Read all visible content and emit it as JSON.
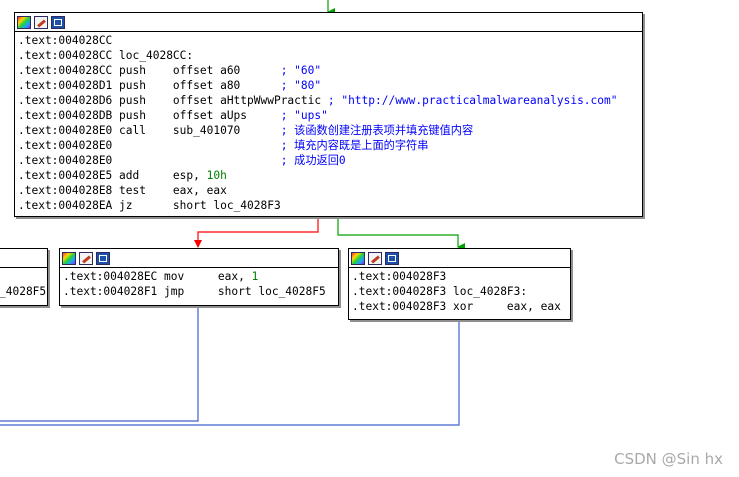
{
  "colors": {
    "edge_true": "#00a000",
    "edge_false": "#ff0000",
    "edge_uncond": "#4060d0"
  },
  "nodes": {
    "main": {
      "lines": [
        [
          ".text:004028CC"
        ],
        [
          ".text:004028CC ",
          "loc_4028CC:"
        ],
        [
          ".text:004028CC ",
          "push    offset a60      ",
          "; \"60\""
        ],
        [
          ".text:004028D1 ",
          "push    offset a80      ",
          "; \"80\""
        ],
        [
          ".text:004028D6 ",
          "push    offset aHttpWwwPractic ",
          "; \"http://www.practicalmalwareanalysis.com\""
        ],
        [
          ".text:004028DB ",
          "push    offset aUps     ",
          "; \"ups\""
        ],
        [
          ".text:004028E0 ",
          "call    sub_401070      ",
          "; 该函数创建注册表项并填充键值内容"
        ],
        [
          ".text:004028E0 ",
          "                        ",
          "; 填充内容既是上面的字符串"
        ],
        [
          ".text:004028E0 ",
          "                        ",
          "; 成功返回0"
        ],
        [
          ".text:004028E5 ",
          "add     esp, ",
          "10h"
        ],
        [
          ".text:004028E8 ",
          "test    eax, eax"
        ],
        [
          ".text:004028EA ",
          "jz      short loc_4028F3"
        ]
      ]
    },
    "left": {
      "lines": [
        [
          ".text:004028EC ",
          "mov     eax, ",
          "1"
        ],
        [
          ".text:004028F1 ",
          "jmp     short loc_4028F5"
        ]
      ]
    },
    "right": {
      "lines": [
        [
          ".text:004028F3"
        ],
        [
          ".text:004028F3 ",
          "loc_4028F3:"
        ],
        [
          ".text:004028F3 ",
          "xor     eax, eax"
        ]
      ]
    },
    "partial": {
      "lines": [
        [
          ""
        ],
        [
          "_4028F5"
        ]
      ]
    }
  },
  "watermark": "CSDN @Sin hx"
}
